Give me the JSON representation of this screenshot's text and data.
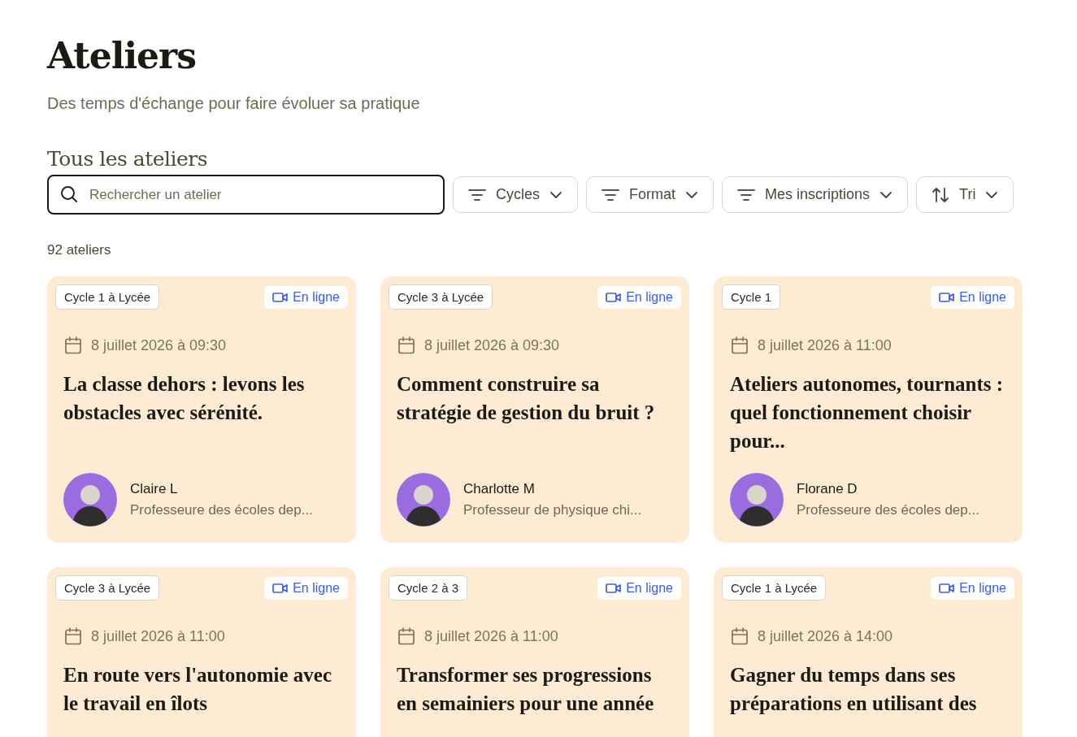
{
  "header": {
    "title": "Ateliers",
    "subtitle": "Des temps d'échange pour faire évoluer sa pratique"
  },
  "section_title": "Tous les ateliers",
  "search": {
    "placeholder": "Rechercher un atelier"
  },
  "filters": [
    {
      "label": "Cycles",
      "kind": "filter"
    },
    {
      "label": "Format",
      "kind": "filter"
    },
    {
      "label": "Mes inscriptions",
      "kind": "filter"
    },
    {
      "label": "Tri",
      "kind": "sort"
    }
  ],
  "count": "92 ateliers",
  "cards": [
    {
      "level_tag": "Cycle 1 à Lycée",
      "format": {
        "label": "En ligne",
        "kind": "online"
      },
      "date": "8 juillet 2026 à 09:30",
      "title": "La classe dehors : levons les obstacles avec sérénité.",
      "author": {
        "name": "Claire L",
        "role": "Professeure des écoles dep..."
      }
    },
    {
      "level_tag": "Cycle 3 à Lycée",
      "format": {
        "label": "En ligne",
        "kind": "online"
      },
      "date": "8 juillet 2026 à 09:30",
      "title": "Comment construire sa stratégie de gestion du bruit ?",
      "author": {
        "name": "Charlotte M",
        "role": "Professeur de physique chi..."
      }
    },
    {
      "level_tag": "Cycle 1",
      "format": {
        "label": "En ligne",
        "kind": "online"
      },
      "date": "8 juillet 2026 à 11:00",
      "title": "Ateliers autonomes, tournants : quel fonctionnement choisir pour...",
      "author": {
        "name": "Florane D",
        "role": "Professeure des écoles dep..."
      }
    },
    {
      "level_tag": "Cycle 3 à Lycée",
      "format": {
        "label": "En ligne",
        "kind": "online"
      },
      "date": "8 juillet 2026 à 11:00",
      "title": "En route vers l'autonomie avec le travail en îlots"
    },
    {
      "level_tag": "Cycle 2 à 3",
      "format": {
        "label": "En ligne",
        "kind": "online"
      },
      "date": "8 juillet 2026 à 11:00",
      "title": "Transformer ses progressions en semainiers pour une année"
    },
    {
      "level_tag": "Cycle 1 à Lycée",
      "format": {
        "label": "En ligne",
        "kind": "online"
      },
      "date": "8 juillet 2026 à 14:00",
      "title": "Gagner du temps dans ses préparations en utilisant des"
    }
  ]
}
